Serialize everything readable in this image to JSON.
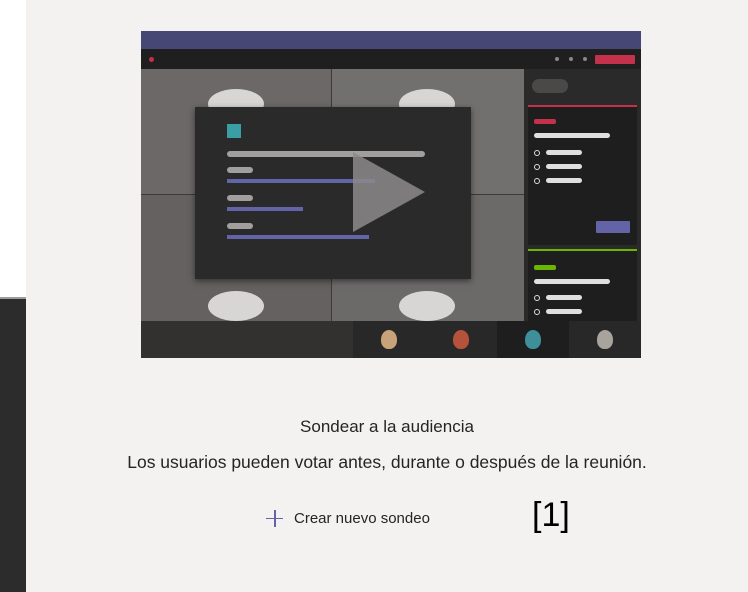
{
  "intro": {
    "title": "Sondear a la audiencia",
    "description": "Los usuarios pueden votar antes, durante o después de la reunión.",
    "create_label": "Crear nuevo sondeo",
    "create_icon": "plus-icon",
    "marker_label": "[1]"
  },
  "colors": {
    "accent": "#6264a7",
    "panel_background": "#f3f2f1",
    "text": "#252424"
  }
}
